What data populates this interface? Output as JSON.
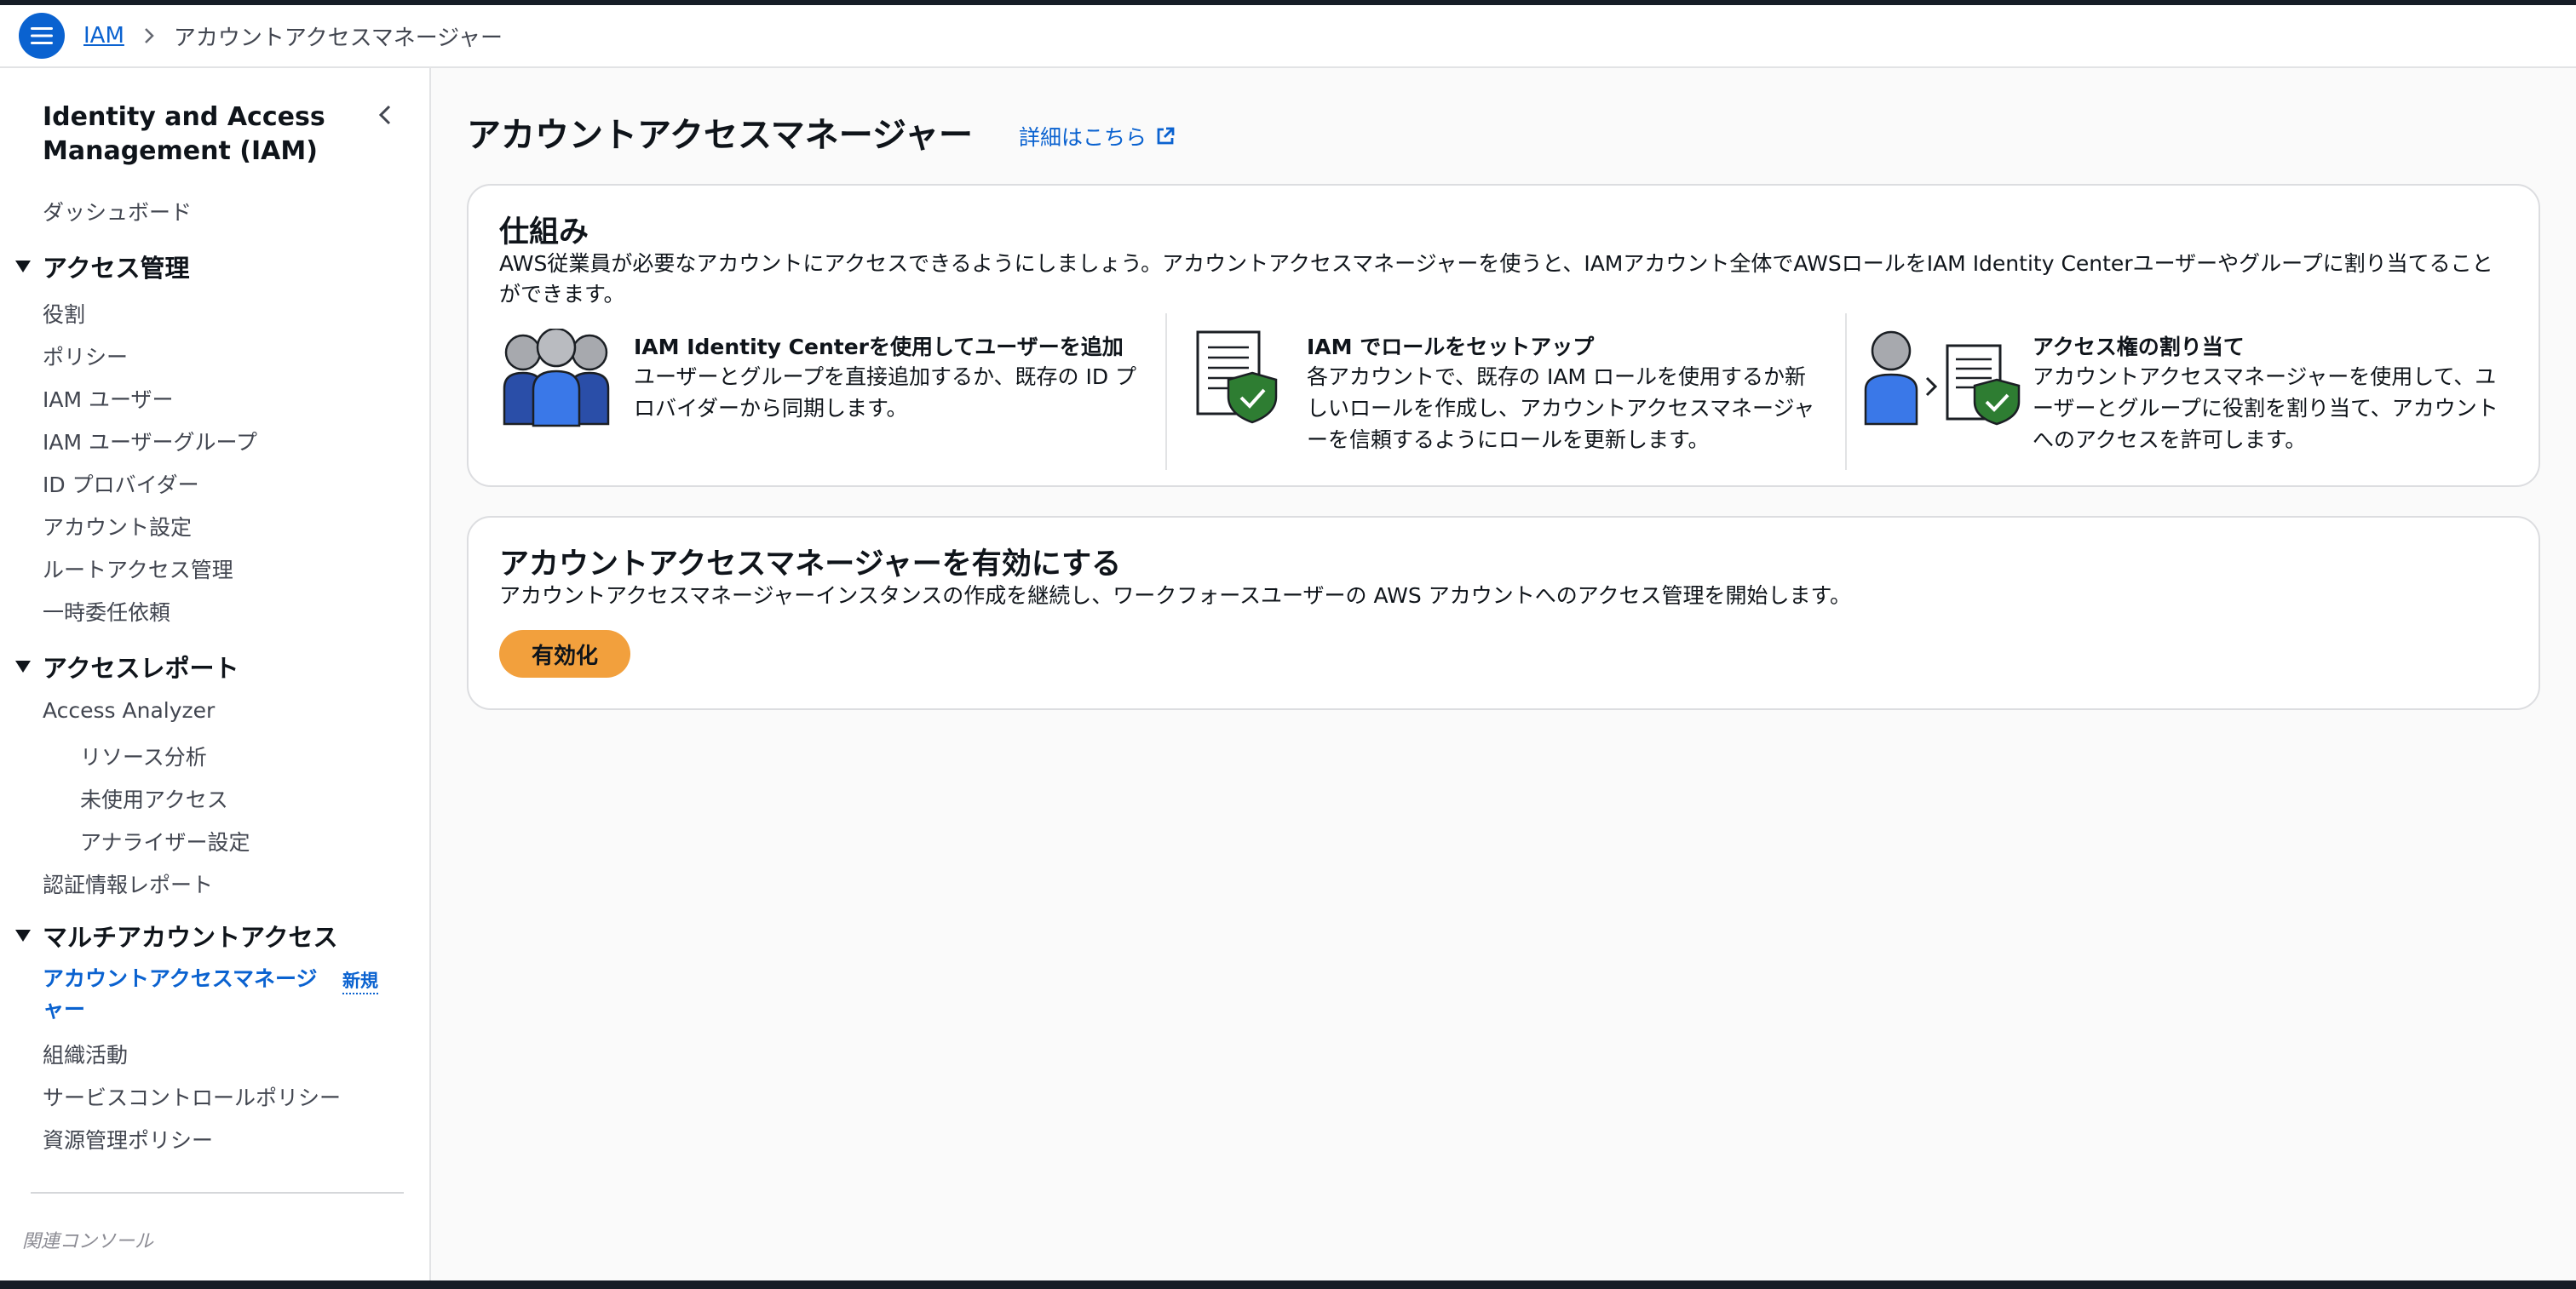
{
  "header": {
    "breadcrumb_root": "IAM",
    "breadcrumb_current": "アカウントアクセスマネージャー"
  },
  "sidebar": {
    "title": "Identity and Access Management (IAM)",
    "dashboard": "ダッシュボード",
    "sections": [
      {
        "label": "アクセス管理",
        "items": [
          "役割",
          "ポリシー",
          "IAM ユーザー",
          "IAM ユーザーグループ",
          "ID プロバイダー",
          "アカウント設定",
          "ルートアクセス管理",
          "一時委任依頼"
        ]
      },
      {
        "label": "アクセスレポート",
        "items": [
          "Access Analyzer",
          "リソース分析",
          "未使用アクセス",
          "アナライザー設定",
          "認証情報レポート"
        ]
      },
      {
        "label": "マルチアカウントアクセス",
        "items": [
          "アカウントアクセスマネージャー",
          "組織活動",
          "サービスコントロールポリシー",
          "資源管理ポリシー"
        ]
      }
    ],
    "new_badge": "新規",
    "related": "関連コンソール"
  },
  "main": {
    "title": "アカウントアクセスマネージャー",
    "info_link": "詳細はこちら",
    "how_it_works": {
      "title": "仕組み",
      "description": "AWS従業員が必要なアカウントにアクセスできるようにしましょう。アカウントアクセスマネージャーを使うと、IAMアカウント全体でAWSロールをIAM Identity Centerユーザーやグループに割り当てることができます。",
      "steps": [
        {
          "icon": "users-group-icon",
          "title": "IAM Identity Centerを使用してユーザーを追加",
          "text": "ユーザーとグループを直接追加するか、既存の ID プロバイダーから同期します。"
        },
        {
          "icon": "document-shield-icon",
          "title": "IAM でロールをセットアップ",
          "text": "各アカウントで、既存の IAM ロールを使用するか新しいロールを作成し、アカウントアクセスマネージャーを信頼するようにロールを更新します。"
        },
        {
          "icon": "user-assign-icon",
          "title": "アクセス権の割り当て",
          "text": "アカウントアクセスマネージャーを使用して、ユーザーとグループに役割を割り当て、アカウントへのアクセスを許可します。"
        }
      ]
    },
    "enable": {
      "title": "アカウントアクセスマネージャーを有効にする",
      "description": "アカウントアクセスマネージャーインスタンスの作成を継続し、ワークフォースユーザーの AWS アカウントへのアクセス管理を開始します。",
      "button": "有効化"
    }
  },
  "colors": {
    "link": "#0a62d0",
    "primary_button": "#f2a03d",
    "shield": "#2e7d32",
    "user_blue": "#2f6fde"
  }
}
